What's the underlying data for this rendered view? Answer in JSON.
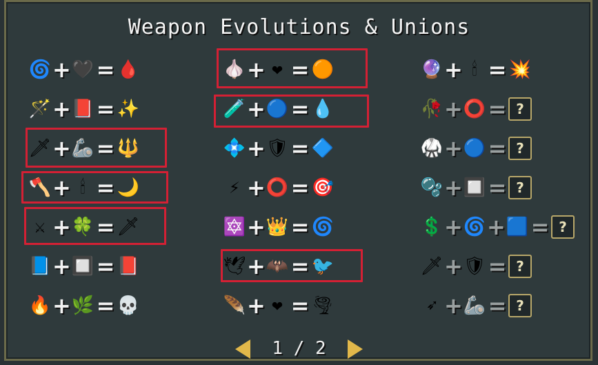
{
  "title": "Weapon Evolutions & Unions",
  "pager": {
    "current": "1",
    "separator": "/",
    "total": "2"
  },
  "symbols": {
    "plus": "+",
    "equals": "=",
    "unknown": "?"
  },
  "columns": [
    {
      "rows": [
        {
          "inputs": [
            "whip-icon",
            "hollow-heart-icon"
          ],
          "result": "bloody-tear-icon",
          "items": [
            "🌀",
            "🖤",
            "🩸"
          ],
          "highlight": false,
          "unknown": false
        },
        {
          "inputs": [
            "magic-wand-icon",
            "empty-tome-icon"
          ],
          "result": "holy-wand-icon",
          "items": [
            "🪄",
            "📕",
            "✨"
          ],
          "highlight": false,
          "unknown": false
        },
        {
          "inputs": [
            "knife-icon",
            "bracer-icon"
          ],
          "result": "thousand-edge-icon",
          "items": [
            "🗡",
            "🦾",
            "🔱"
          ],
          "highlight": true,
          "unknown": false
        },
        {
          "inputs": [
            "axe-icon",
            "candelabrador-icon"
          ],
          "result": "death-spiral-icon",
          "items": [
            "🪓",
            "🕯",
            "🌙"
          ],
          "highlight": true,
          "unknown": false
        },
        {
          "inputs": [
            "cross-icon",
            "clover-icon"
          ],
          "result": "heaven-sword-icon",
          "items": [
            "⚔",
            "🍀",
            "🗡"
          ],
          "highlight": true,
          "unknown": false
        },
        {
          "inputs": [
            "king-bible-icon",
            "spellbinder-icon"
          ],
          "result": "unholy-vespers-icon",
          "items": [
            "📘",
            "🔲",
            "📕"
          ],
          "highlight": false,
          "unknown": false
        },
        {
          "inputs": [
            "fire-wand-icon",
            "spinach-icon"
          ],
          "result": "hellfire-icon",
          "items": [
            "🔥",
            "🌿",
            "💀"
          ],
          "highlight": false,
          "unknown": false
        }
      ]
    },
    {
      "rows": [
        {
          "inputs": [
            "garlic-icon",
            "pummarola-icon"
          ],
          "result": "soul-eater-icon",
          "items": [
            "🧄",
            "❤",
            "🟠"
          ],
          "highlight": true,
          "unknown": false
        },
        {
          "inputs": [
            "santa-water-icon",
            "attractorb-icon"
          ],
          "result": "la-borra-icon",
          "items": [
            "🧪",
            "🔵",
            "💧"
          ],
          "highlight": true,
          "unknown": false
        },
        {
          "inputs": [
            "runetracer-icon",
            "armor-icon"
          ],
          "result": "no-future-icon",
          "items": [
            "💠",
            "🛡",
            "🔷"
          ],
          "highlight": false,
          "unknown": false
        },
        {
          "inputs": [
            "lightning-ring-icon",
            "duplicator-icon"
          ],
          "result": "thunder-loop-icon",
          "items": [
            "⚡",
            "⭕",
            "🎯"
          ],
          "highlight": false,
          "unknown": false
        },
        {
          "inputs": [
            "pentagram-icon",
            "crown-icon"
          ],
          "result": "gorgeous-moon-icon",
          "items": [
            "🔯",
            "👑",
            "🌀"
          ],
          "highlight": false,
          "unknown": false
        },
        {
          "inputs": [
            "peachone-icon",
            "ebony-wings-icon"
          ],
          "result": "vandalier-icon",
          "items": [
            "🕊",
            "🦇",
            "🐦"
          ],
          "highlight": true,
          "unknown": false
        },
        {
          "inputs": [
            "song-of-mana-icon",
            "skull-omaniac-icon"
          ],
          "result": "mannajja-icon",
          "items": [
            "🪶",
            "❤",
            "🌪"
          ],
          "highlight": false,
          "unknown": false
        }
      ]
    },
    {
      "rows": [
        {
          "inputs": [
            "gatti-amari-icon",
            "stone-mask-icon"
          ],
          "result": "vicious-hunger-icon",
          "items": [
            "🔮",
            "🕯",
            "💥"
          ],
          "highlight": false,
          "unknown": false
        },
        {
          "inputs": [
            "clock-lancet-icon",
            "silver-ring-icon"
          ],
          "result": "unknown-icon",
          "items": [
            "🥀",
            "⭕",
            ""
          ],
          "highlight": false,
          "unknown": true
        },
        {
          "inputs": [
            "laurel-icon",
            "attractorb-icon"
          ],
          "result": "unknown-icon",
          "items": [
            "🥋",
            "🔵",
            ""
          ],
          "highlight": false,
          "unknown": true
        },
        {
          "inputs": [
            "bone-icon",
            "spellbinder-icon"
          ],
          "result": "unknown-icon",
          "items": [
            "🫧",
            "🔲",
            ""
          ],
          "highlight": false,
          "unknown": true
        },
        {
          "inputs": [
            "cherry-bomb-icon",
            "carrello-icon",
            "celestial-dusting-icon"
          ],
          "result": "unknown-icon",
          "items": [
            "💲",
            "🌀",
            "🟦",
            ""
          ],
          "highlight": false,
          "unknown": true
        },
        {
          "inputs": [
            "la-robba-icon",
            "armor-icon"
          ],
          "result": "unknown-icon",
          "items": [
            "🗡",
            "🛡",
            ""
          ],
          "highlight": false,
          "unknown": true
        },
        {
          "inputs": [
            "arrow-icon",
            "bracer-icon"
          ],
          "result": "unknown-icon",
          "items": [
            "➶",
            "🦾",
            ""
          ],
          "highlight": false,
          "unknown": true
        }
      ]
    }
  ],
  "colors": {
    "highlight": "#d42034",
    "border": "#6b6a4a",
    "arrow": "#e2b84a"
  }
}
